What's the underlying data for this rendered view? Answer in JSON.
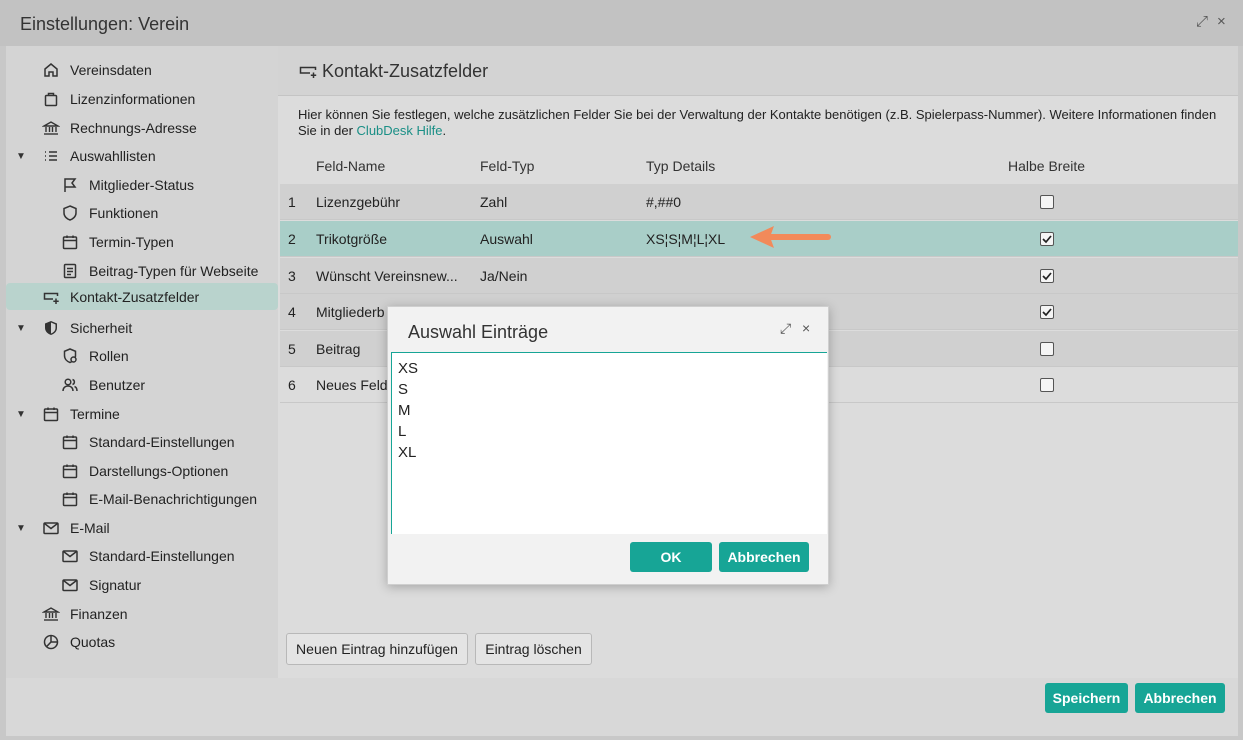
{
  "window": {
    "title": "Einstellungen: Verein",
    "expand_glyph": "⤢",
    "close_glyph": "×"
  },
  "sidebar": {
    "items": [
      {
        "label": "Vereinsdaten",
        "icon": "home-icon"
      },
      {
        "label": "Lizenzinformationen",
        "icon": "shopping-bag-icon"
      },
      {
        "label": "Rechnungs-Adresse",
        "icon": "bank-icon"
      },
      {
        "label": "Auswahllisten",
        "icon": "list-icon",
        "expanded": true
      },
      {
        "label": "Mitglieder-Status",
        "icon": "flag-icon"
      },
      {
        "label": "Funktionen",
        "icon": "shield-outline-icon"
      },
      {
        "label": "Termin-Typen",
        "icon": "calendar-icon"
      },
      {
        "label": "Beitrag-Typen für Webseite",
        "icon": "document-icon"
      },
      {
        "label": "Kontakt-Zusatzfelder",
        "icon": "add-field-icon",
        "selected": true
      },
      {
        "label": "Sicherheit",
        "icon": "shield-icon",
        "expanded": true
      },
      {
        "label": "Rollen",
        "icon": "user-role-icon"
      },
      {
        "label": "Benutzer",
        "icon": "users-icon"
      },
      {
        "label": "Termine",
        "icon": "calendar-icon",
        "expanded": true
      },
      {
        "label": "Standard-Einstellungen",
        "icon": "calendar-icon"
      },
      {
        "label": "Darstellungs-Optionen",
        "icon": "calendar-icon"
      },
      {
        "label": "E-Mail-Benachrichtigungen",
        "icon": "calendar-icon"
      },
      {
        "label": "E-Mail",
        "icon": "mail-icon",
        "expanded": true
      },
      {
        "label": "Standard-Einstellungen",
        "icon": "mail-icon"
      },
      {
        "label": "Signatur",
        "icon": "mail-icon"
      },
      {
        "label": "Finanzen",
        "icon": "bank-icon"
      },
      {
        "label": "Quotas",
        "icon": "pie-chart-icon"
      }
    ]
  },
  "main": {
    "title": "Kontakt-Zusatzfelder",
    "description": "Hier können Sie festlegen, welche zusätzlichen Felder Sie bei der Verwaltung der Kontakte benötigen (z.B. Spielerpass-Nummer). Weitere Informationen finden Sie in der ",
    "description_link": "ClubDesk Hilfe",
    "description_end": ".",
    "columns": [
      "Feld-Name",
      "Feld-Typ",
      "Typ Details",
      "Halbe Breite"
    ],
    "rows": [
      {
        "num": "1",
        "name": "Lizenzgebühr",
        "type": "Zahl",
        "details": "#,##0",
        "half": false
      },
      {
        "num": "2",
        "name": "Trikotgröße",
        "type": "Auswahl",
        "details": "XS¦S¦M¦L¦XL",
        "half": true,
        "selected": true
      },
      {
        "num": "3",
        "name": "Wünscht Vereinsnew...",
        "type": "Ja/Nein",
        "details": "",
        "half": true
      },
      {
        "num": "4",
        "name": "Mitgliederb",
        "type": "",
        "details": "",
        "half": true
      },
      {
        "num": "5",
        "name": "Beitrag",
        "type": "",
        "details": "",
        "half": false
      },
      {
        "num": "6",
        "name": "Neues Feld",
        "type": "",
        "details": "",
        "half": false
      }
    ],
    "add_button": "Neuen Eintrag hinzufügen",
    "delete_button": "Eintrag löschen"
  },
  "footer": {
    "save": "Speichern",
    "cancel": "Abbrechen"
  },
  "dialog": {
    "title": "Auswahl Einträge",
    "entries": "XS\nS\nM\nL\nXL",
    "ok": "OK",
    "cancel": "Abbrechen"
  },
  "colors": {
    "accent": "#17a596",
    "selected_row": "#a9cec8",
    "arrow": "#f28a5a"
  }
}
